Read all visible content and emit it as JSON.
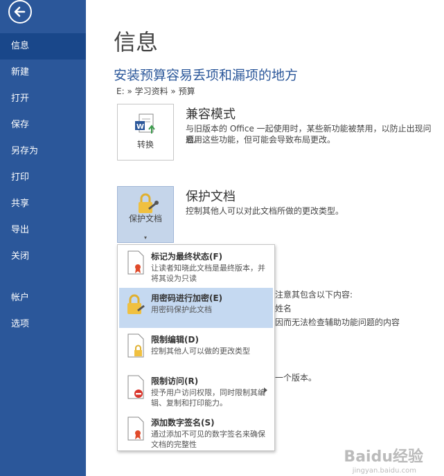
{
  "sidebar": {
    "items": [
      {
        "label": "信息"
      },
      {
        "label": "新建"
      },
      {
        "label": "打开"
      },
      {
        "label": "保存"
      },
      {
        "label": "另存为"
      },
      {
        "label": "打印"
      },
      {
        "label": "共享"
      },
      {
        "label": "导出"
      },
      {
        "label": "关闭"
      },
      {
        "label": "帐户"
      },
      {
        "label": "选项"
      }
    ]
  },
  "main": {
    "page_title": "信息",
    "doc_title": "安装预算容易丢项和漏项的地方",
    "doc_path": "E: » 学习资料 » 预算",
    "compat": {
      "tile_label": "转换",
      "heading": "兼容模式",
      "desc_line1": "与旧版本的 Office 一起使用时，某些新功能被禁用，以防止出现问题。",
      "desc_line2": "启用这些功能，但可能会导致布局更改。"
    },
    "protect": {
      "tile_label": "保护文档",
      "heading": "保护文档",
      "desc": "控制其他人可以对此文档所做的更改类型。"
    },
    "behind_text": {
      "line1": "注意其包含以下内容:",
      "line2": "姓名",
      "line3": "因而无法检查辅助功能问题的内容",
      "line4": "一个版本。"
    }
  },
  "protect_menu": {
    "items": [
      {
        "title": "标记为最终状态(F)",
        "desc": "让读者知晓此文档是最终版本，并将其设为只读"
      },
      {
        "title": "用密码进行加密(E)",
        "desc": "用密码保护此文档"
      },
      {
        "title": "限制编辑(D)",
        "desc": "控制其他人可以做的更改类型"
      },
      {
        "title": "限制访问(R)",
        "desc": "授予用户访问权限，同时限制其编辑、复制和打印能力。"
      },
      {
        "title": "添加数字签名(S)",
        "desc": "通过添加不可见的数字签名来确保文档的完整性"
      }
    ]
  },
  "watermark": {
    "text": "Baidu经验",
    "url": "jingyan.baidu.com"
  },
  "colors": {
    "sidebar": "#2b579a",
    "accent": "#2b579a",
    "highlight": "#c5d9f1"
  }
}
